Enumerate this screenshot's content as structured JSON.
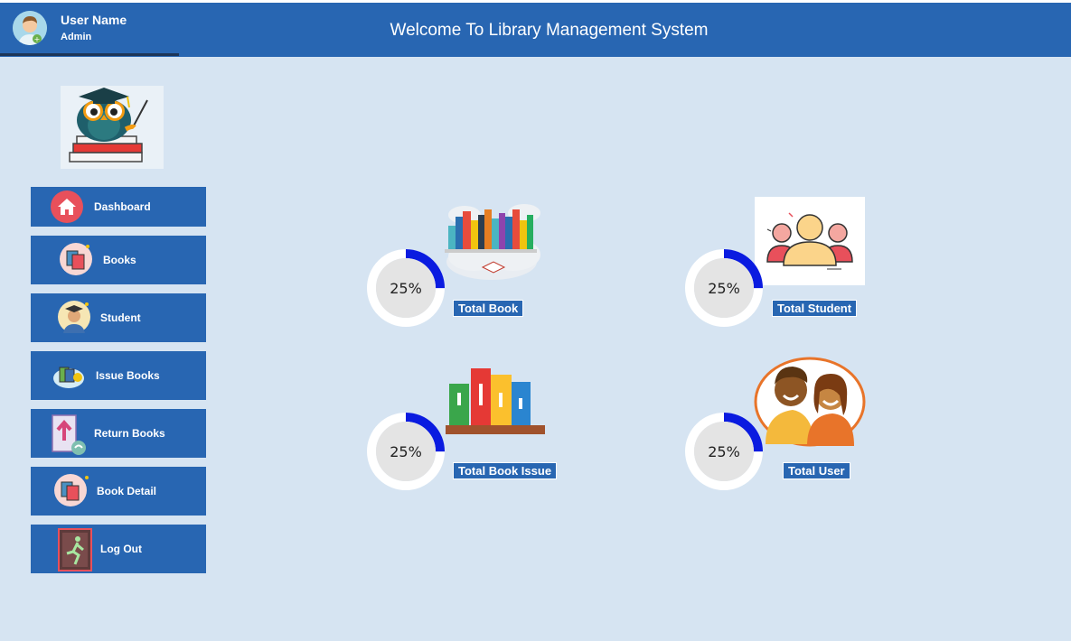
{
  "header": {
    "user_name": "User Name",
    "user_role": "Admin",
    "title": "Welcome To Library Management System"
  },
  "sidebar": {
    "items": [
      {
        "label": "Dashboard",
        "icon": "home-icon"
      },
      {
        "label": "Books",
        "icon": "books-icon"
      },
      {
        "label": "Student",
        "icon": "student-icon"
      },
      {
        "label": "Issue Books",
        "icon": "issue-books-icon"
      },
      {
        "label": "Return Books",
        "icon": "return-books-icon"
      },
      {
        "label": "Book Detail",
        "icon": "book-detail-icon"
      },
      {
        "label": "Log Out",
        "icon": "exit-icon"
      }
    ]
  },
  "stats": [
    {
      "label": "Total Book",
      "percent_text": "25%",
      "progress": 0.25,
      "illustration": "bookshelf-cloud-illustration"
    },
    {
      "label": "Total Student",
      "percent_text": "25%",
      "progress": 0.25,
      "illustration": "students-group-illustration"
    },
    {
      "label": "Total Book Issue",
      "percent_text": "25%",
      "progress": 0.25,
      "illustration": "books-on-shelf-illustration"
    },
    {
      "label": "Total User",
      "percent_text": "25%",
      "progress": 0.25,
      "illustration": "users-couple-illustration"
    }
  ],
  "colors": {
    "background": "#d6e4f2",
    "primary": "#2866b2",
    "ring_track": "#ffffff",
    "ring_fill": "#0a1be0",
    "ring_center": "#e4e4e4"
  }
}
